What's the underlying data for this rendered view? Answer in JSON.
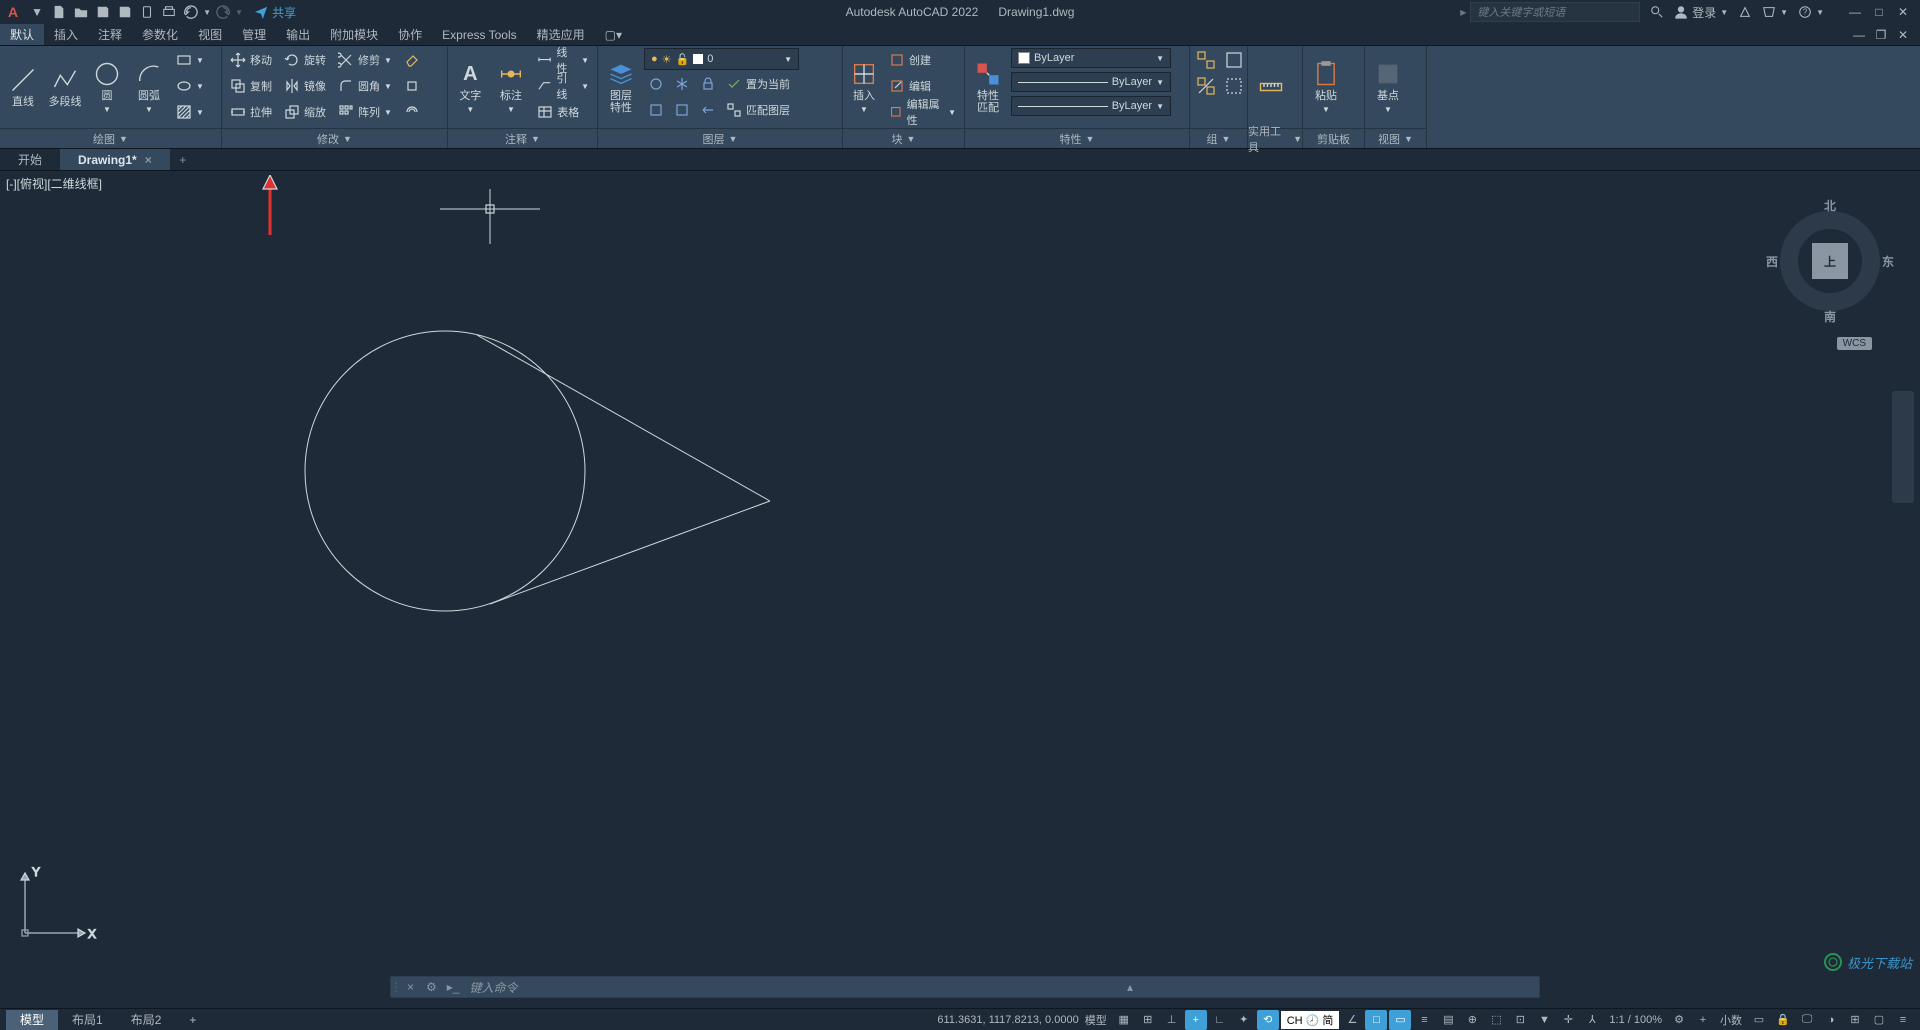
{
  "titlebar": {
    "app_brand": "A",
    "share": "共享",
    "product": "Autodesk AutoCAD 2022",
    "filename": "Drawing1.dwg",
    "search_placeholder": "键入关键字或短语",
    "login": "登录"
  },
  "menus": [
    "默认",
    "插入",
    "注释",
    "参数化",
    "视图",
    "管理",
    "输出",
    "附加模块",
    "协作",
    "Express Tools",
    "精选应用"
  ],
  "ribbon": {
    "draw": {
      "title": "绘图",
      "line": "直线",
      "pline": "多段线",
      "circle": "圆",
      "arc": "圆弧"
    },
    "modify": {
      "title": "修改",
      "move": "移动",
      "rotate": "旋转",
      "trim": "修剪",
      "copy": "复制",
      "mirror": "镜像",
      "fillet": "圆角",
      "stretch": "拉伸",
      "scale": "缩放",
      "array": "阵列"
    },
    "annotate": {
      "title": "注释",
      "text": "文字",
      "dim": "标注",
      "leader": "引线",
      "table": "表格",
      "linear": "线性"
    },
    "layers": {
      "title": "图层",
      "layer_btn": "图层\n特性",
      "current": "0",
      "make_current": "置为当前",
      "match": "匹配图层"
    },
    "block": {
      "title": "块",
      "insert": "插入",
      "create": "创建",
      "edit": "编辑",
      "attr": "编辑属性"
    },
    "props": {
      "title": "特性",
      "match": "特性\n匹配",
      "bylayer": "ByLayer"
    },
    "group": {
      "title": "组"
    },
    "utils": {
      "title": "实用工具"
    },
    "clip": {
      "title": "剪贴板",
      "paste": "粘贴"
    },
    "view": {
      "title": "视图",
      "basept": "基点"
    }
  },
  "doctabs": {
    "start": "开始",
    "drawing": "Drawing1*"
  },
  "canvas": {
    "viewport_label": "[-][俯视][二维线框]",
    "viewcube": {
      "top": "上",
      "n": "北",
      "s": "南",
      "e": "东",
      "w": "西",
      "wcs": "WCS"
    }
  },
  "cmdline": {
    "placeholder": "键入命令"
  },
  "modeltabs": [
    "模型",
    "布局1",
    "布局2"
  ],
  "statusbar": {
    "coords": "611.3631, 1117.8213, 0.0000",
    "model": "模型",
    "ime": "CH 🕗 简",
    "scale": "1:1 / 100%",
    "dec": "小数"
  },
  "watermark": "极光下载站"
}
